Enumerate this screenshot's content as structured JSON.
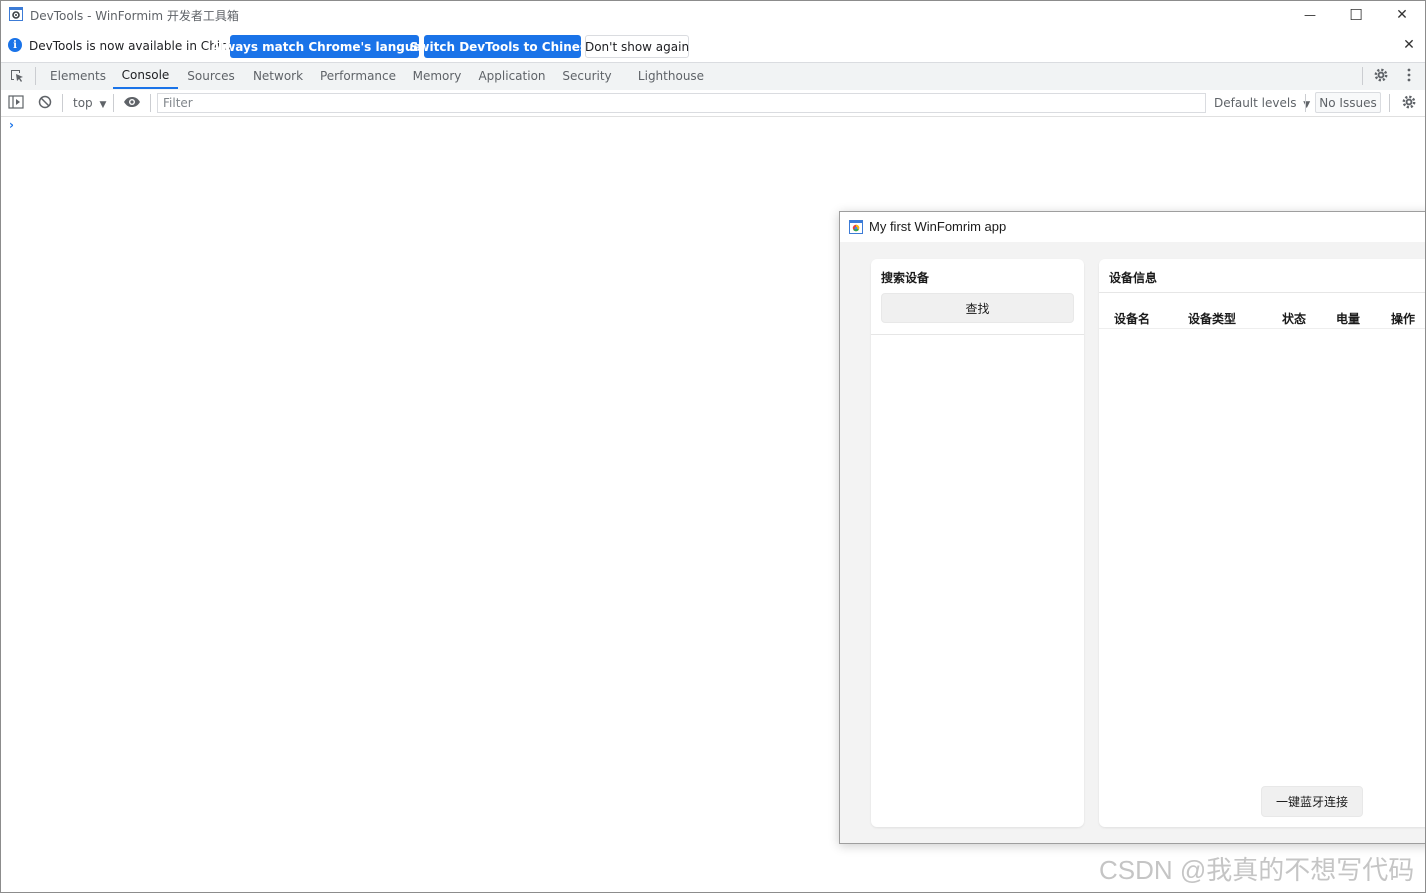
{
  "window": {
    "title": "DevTools - WinFormim 开发者工具箱",
    "minimize_glyph": "—",
    "maximize_glyph": "☐",
    "close_glyph": "✕"
  },
  "infobar": {
    "message": "DevTools is now available in Chinese!",
    "match_language_label": "Always match Chrome's language",
    "switch_label": "Switch DevTools to Chinese",
    "dismiss_label": "Don't show again",
    "close_glyph": "✕"
  },
  "tabs": [
    {
      "label": "Elements"
    },
    {
      "label": "Console",
      "active": true
    },
    {
      "label": "Sources"
    },
    {
      "label": "Network"
    },
    {
      "label": "Performance"
    },
    {
      "label": "Memory"
    },
    {
      "label": "Application"
    },
    {
      "label": "Security"
    },
    {
      "label": "Lighthouse"
    }
  ],
  "console_toolbar": {
    "context": "top",
    "filter_placeholder": "Filter",
    "levels": "Default levels",
    "issues": "No Issues",
    "prompt": "›"
  },
  "app": {
    "title": "My first WinFomrim app",
    "search_panel": {
      "title": "搜索设备",
      "find_button": "查找"
    },
    "device_panel": {
      "title": "设备信息",
      "columns": [
        "设备名",
        "设备类型",
        "状态",
        "电量",
        "操作"
      ],
      "connect_button": "一键蓝牙连接"
    }
  },
  "watermark": "CSDN @我真的不想写代码",
  "colors": {
    "accent": "#1a73e8",
    "tab_bg": "#f1f3f4",
    "app_bg": "#f3f3f3"
  }
}
